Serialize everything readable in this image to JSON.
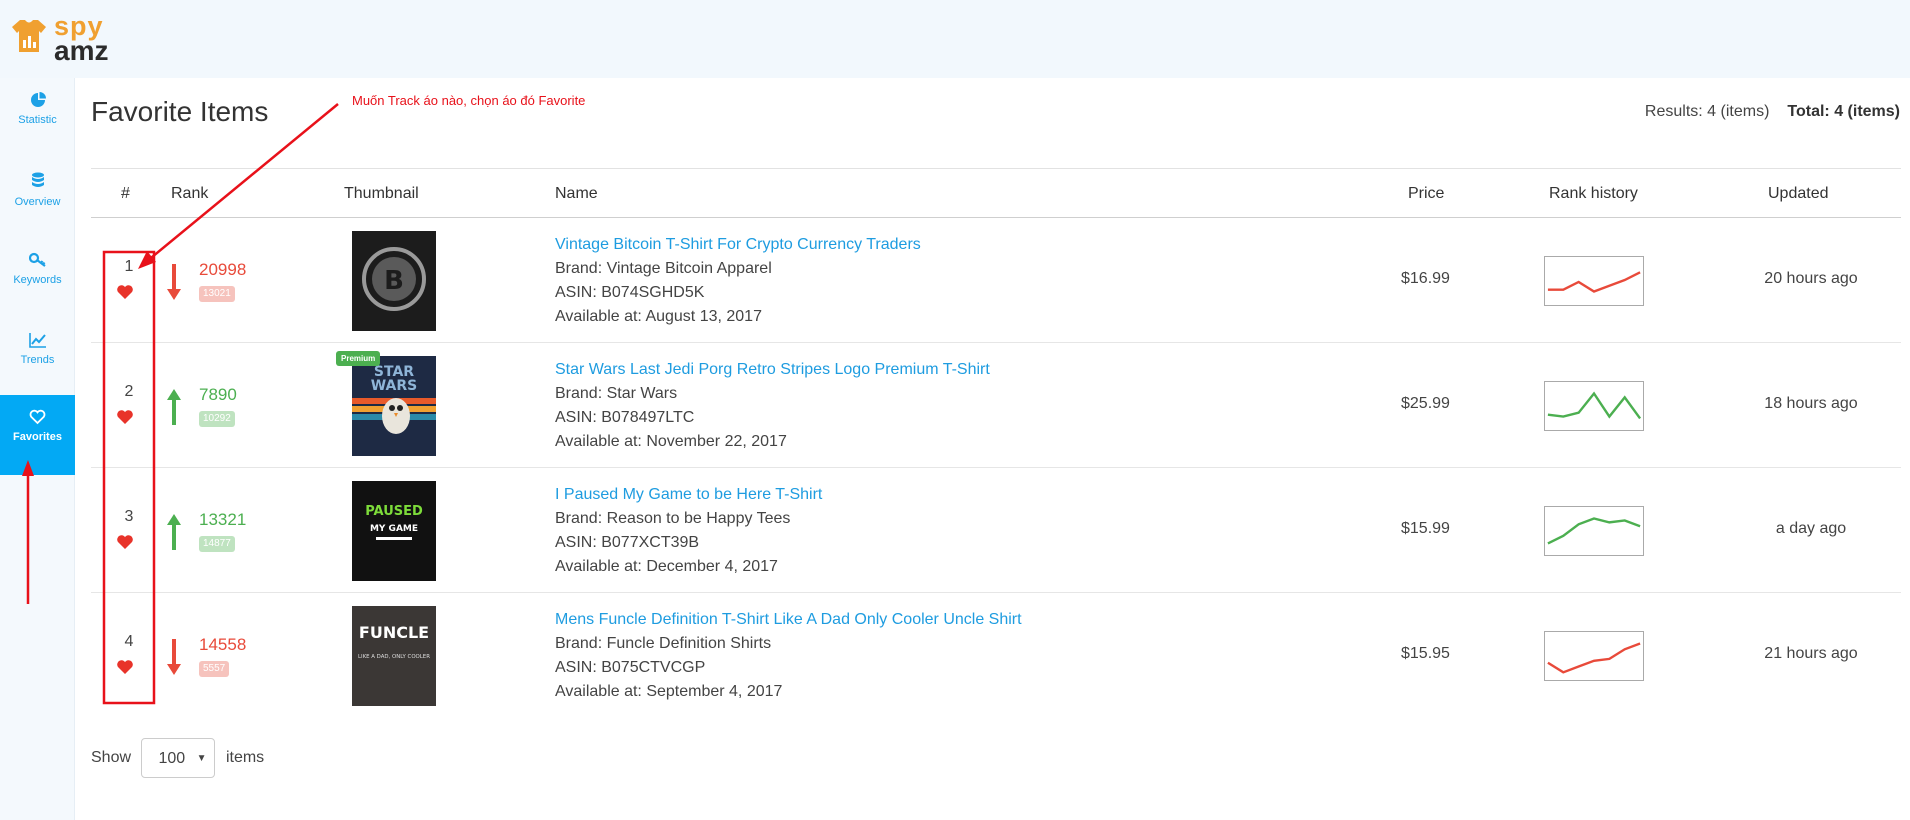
{
  "logo": {
    "line1": "spy",
    "line2": "amz"
  },
  "sidebar": {
    "items": [
      {
        "label": "Statistic",
        "icon": "pie-chart-icon"
      },
      {
        "label": "Overview",
        "icon": "database-icon"
      },
      {
        "label": "Keywords",
        "icon": "key-icon"
      },
      {
        "label": "Trends",
        "icon": "line-chart-icon"
      },
      {
        "label": "Favorites",
        "icon": "heart-icon",
        "active": true
      }
    ]
  },
  "page": {
    "title": "Favorite Items",
    "results": "Results: 4 (items)",
    "total": "Total: 4 (items)"
  },
  "annotation": "Muốn Track áo nào, chọn áo đó Favorite",
  "table": {
    "headers": {
      "num": "#",
      "rank": "Rank",
      "thumbnail": "Thumbnail",
      "name": "Name",
      "price": "Price",
      "rank_history": "Rank history",
      "updated": "Updated"
    },
    "rows": [
      {
        "num": "1",
        "trend": "down",
        "rank": "20998",
        "badge": "13021",
        "premium": "",
        "thumb_text": [
          "",
          ""
        ],
        "name": "Vintage Bitcoin T-Shirt For Crypto Currency Traders",
        "brand": "Brand: Vintage Bitcoin Apparel",
        "asin": "ASIN: B074SGHD5K",
        "available": "Available at: August 13, 2017",
        "price": "$16.99",
        "updated": "20 hours ago",
        "history": [
          12,
          12,
          20,
          10,
          16,
          22,
          30
        ]
      },
      {
        "num": "2",
        "trend": "up",
        "rank": "7890",
        "badge": "10292",
        "premium": "Premium",
        "thumb_text": [
          "STAR",
          "WARS"
        ],
        "name": "Star Wars Last Jedi Porg Retro Stripes Logo Premium T-Shirt",
        "brand": "Brand: Star Wars",
        "asin": "ASIN: B078497LTC",
        "available": "Available at: November 22, 2017",
        "price": "$25.99",
        "updated": "18 hours ago",
        "history": [
          12,
          10,
          14,
          34,
          10,
          30,
          8
        ]
      },
      {
        "num": "3",
        "trend": "up",
        "rank": "13321",
        "badge": "14877",
        "premium": "",
        "thumb_text": [
          "PAUSED",
          "MY GAME"
        ],
        "name": "I Paused My Game to be Here T-Shirt",
        "brand": "Brand: Reason to be Happy Tees",
        "asin": "ASIN: B077XCT39B",
        "available": "Available at: December 4, 2017",
        "price": "$15.99",
        "updated": "a day ago",
        "history": [
          8,
          16,
          28,
          34,
          30,
          32,
          26
        ]
      },
      {
        "num": "4",
        "trend": "down",
        "rank": "14558",
        "badge": "5557",
        "premium": "",
        "thumb_text": [
          "FUNCLE",
          "LIKE A DAD, ONLY COOLER"
        ],
        "name": "Mens Funcle Definition T-Shirt Like A Dad Only Cooler Uncle Shirt",
        "brand": "Brand: Funcle Definition Shirts",
        "asin": "ASIN: B075CTVCGP",
        "available": "Available at: September 4, 2017",
        "price": "$15.95",
        "updated": "21 hours ago",
        "history": [
          14,
          4,
          10,
          16,
          18,
          28,
          34
        ]
      }
    ]
  },
  "footer": {
    "show": "Show",
    "value": "100",
    "items": "items"
  },
  "colors": {
    "accent": "#03a9f4",
    "link": "#1e9ce0",
    "down": "#e84a3a",
    "up": "#4caf50",
    "annotation": "#e8111a"
  }
}
